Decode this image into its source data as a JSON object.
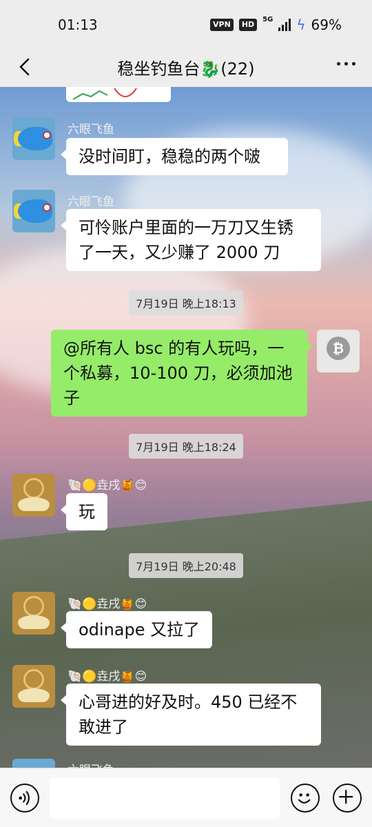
{
  "status_bar": {
    "time": "01:13",
    "vpn": "VPN",
    "hd": "HD",
    "network": "5G",
    "battery": "69%"
  },
  "header": {
    "title": "稳坐钓鱼台🐉(22)"
  },
  "messages": [
    {
      "sender": "六眼飞鱼",
      "text": "没时间盯，稳稳的两个啵"
    },
    {
      "sender": "六眼飞鱼",
      "text": "可怜账户里面的一万刀又生锈了一天，又少赚了 2000 刀"
    },
    {
      "timestamp": "7月19日 晚上18:13"
    },
    {
      "sender": "self",
      "text": "@所有人 bsc 的有人玩吗，一个私募，10-100 刀，必须加池子"
    },
    {
      "timestamp": "7月19日 晚上18:24"
    },
    {
      "sender": "🐚🟡垚戌🍯😊",
      "text": "玩"
    },
    {
      "timestamp": "7月19日 晚上20:48"
    },
    {
      "sender": "🐚🟡垚戌🍯😊",
      "text": "odinape 又拉了"
    },
    {
      "sender": "🐚🟡垚戌🍯😊",
      "text": "心哥进的好及时。450 已经不敢进了"
    },
    {
      "sender": "六眼飞鱼",
      "text": ""
    }
  ],
  "icons": {
    "back": "chevron-left-icon",
    "more": "more-dots-icon",
    "voice": "voice-icon",
    "emoji": "emoji-icon",
    "plus": "plus-icon"
  },
  "colors": {
    "outgoing_bubble": "#95ec69",
    "incoming_bubble": "#ffffff",
    "background": "#ededed"
  }
}
